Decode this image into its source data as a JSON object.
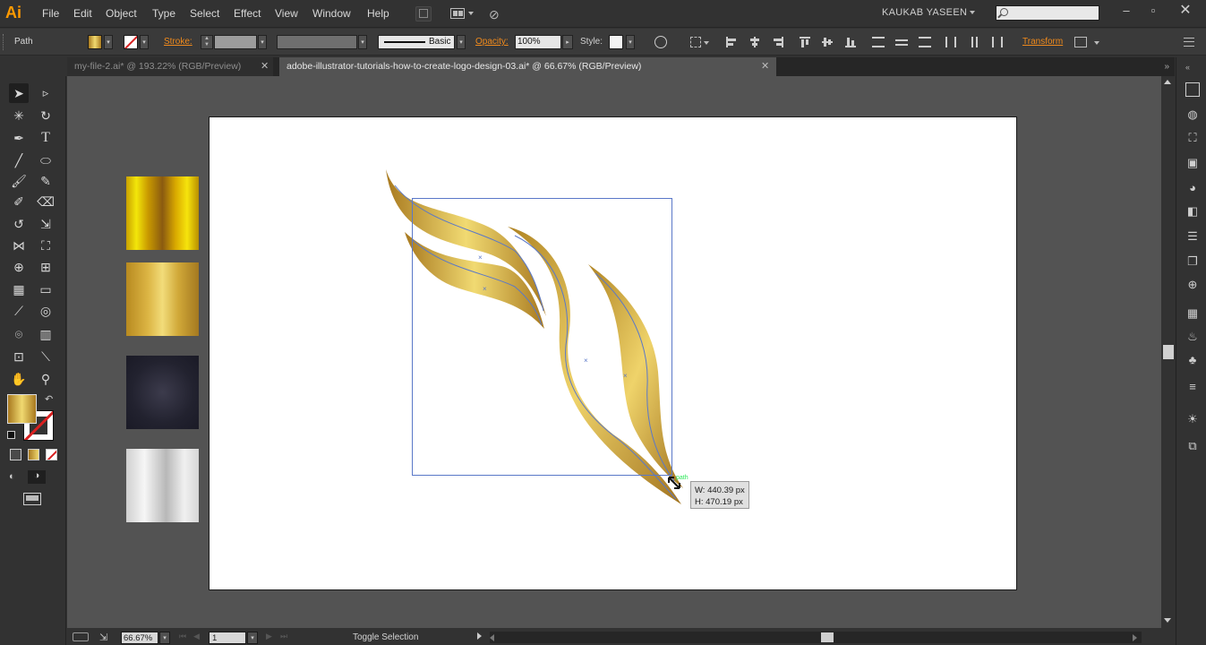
{
  "app": {
    "logo": "Ai"
  },
  "menu": [
    "File",
    "Edit",
    "Object",
    "Type",
    "Select",
    "Effect",
    "View",
    "Window",
    "Help"
  ],
  "user": {
    "name": "KAUKAB YASEEN"
  },
  "control": {
    "selection_type": "Path",
    "stroke_label": "Stroke:",
    "brush_label": "Basic",
    "opacity_label": "Opacity:",
    "opacity_value": "100%",
    "style_label": "Style:",
    "transform_label": "Transform"
  },
  "tabs": [
    {
      "label": "my-file-2.ai* @ 193.22% (RGB/Preview)",
      "active": false
    },
    {
      "label": "adobe-illustrator-tutorials-how-to-create-logo-design-03.ai* @ 66.67% (RGB/Preview)",
      "active": true
    }
  ],
  "tooltip": {
    "width": "W: 440.39 px",
    "height": "H: 470.19 px"
  },
  "status": {
    "zoom": "66.67%",
    "page": "1",
    "text": "Toggle Selection"
  },
  "colors": {
    "gold_dark": "#a8791f",
    "gold_light": "#f0d970",
    "accent": "#f08a1c",
    "selection": "#5a78c8"
  }
}
